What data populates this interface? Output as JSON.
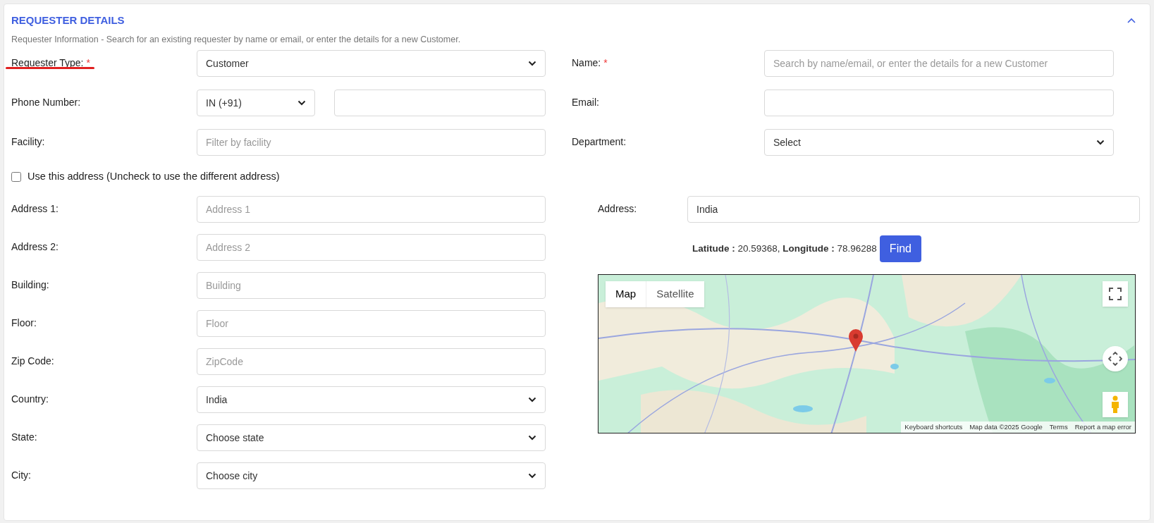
{
  "section": {
    "title": "REQUESTER DETAILS",
    "expanded": true,
    "description": "Requester Information - Search for an existing requester by name or email, or enter the details for a new Customer."
  },
  "left_fields": [
    {
      "label": "Requester Type:",
      "required_mark": "*",
      "underlined": true,
      "kind": "select",
      "value": "Customer"
    },
    {
      "label": "Phone Number:",
      "underlined": false,
      "kind": "phone",
      "value": "IN (+91)"
    },
    {
      "label": "Facility:",
      "underlined": false,
      "kind": "input",
      "placeholder": "Filter by facility"
    }
  ],
  "right_fields": [
    {
      "label": "Name:",
      "required_mark": "*",
      "kind": "input",
      "placeholder": "Search by name/email, or enter the details for a new Customer"
    },
    {
      "label": "Email:",
      "kind": "input"
    },
    {
      "label": "Department:",
      "kind": "select",
      "value": "Select"
    }
  ],
  "use_address": {
    "label": "Use this address (Uncheck to use the different address)",
    "checked": false
  },
  "address_fields": [
    {
      "label": "Address 1:",
      "kind": "input",
      "placeholder": "Address 1"
    },
    {
      "label": "Address 2:",
      "kind": "input",
      "placeholder": "Address 2"
    },
    {
      "label": "Building:",
      "kind": "input",
      "placeholder": "Building"
    },
    {
      "label": "Floor:",
      "kind": "input",
      "placeholder": "Floor"
    },
    {
      "label": "Zip Code:",
      "kind": "input",
      "placeholder": "ZipCode"
    },
    {
      "label": "Country:",
      "kind": "select",
      "value": "India"
    },
    {
      "label": "State:",
      "kind": "select",
      "value": "Choose state"
    },
    {
      "label": "City:",
      "kind": "select",
      "value": "Choose city"
    }
  ],
  "location": {
    "address_label": "Address:",
    "address_value": "India",
    "coordinates": "**Latitude :** 20.59368, **Longitude :** 78.96288",
    "find_button": "Find"
  },
  "map": {
    "kind": "picture",
    "map_types": [
      {
        "label": "Map",
        "selected": true
      },
      {
        "label": "Satellite",
        "selected": false
      }
    ],
    "footer_links": [
      "Keyboard shortcuts",
      "Map data ©2025 Google",
      "Terms",
      "Report a map error"
    ]
  }
}
